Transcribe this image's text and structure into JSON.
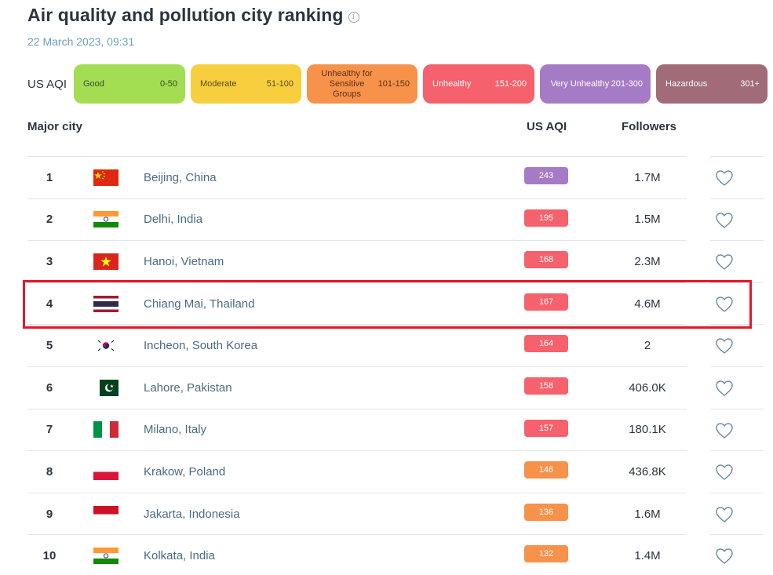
{
  "page": {
    "title": "Air quality and pollution city ranking",
    "info_icon_glyph": "i",
    "timestamp": "22 March 2023, 09:31"
  },
  "legend": {
    "label": "US AQI",
    "items": [
      {
        "name": "Good",
        "range": "0-50",
        "color": "#a3dd52",
        "text_color": "#3b4a2a",
        "width": 142
      },
      {
        "name": "Moderate",
        "range": "51-100",
        "color": "#f7cf3e",
        "text_color": "#5a4a1a",
        "width": 141
      },
      {
        "name": "Unhealthy for Sensitive Groups",
        "range": "101-150",
        "color": "#f7924a",
        "text_color": "#5a3218",
        "width": 141
      },
      {
        "name": "Unhealthy",
        "range": "151-200",
        "color": "#f5616c",
        "text_color": "#ffffff",
        "width": 142
      },
      {
        "name": "Very Unhealthy",
        "range": "201-300",
        "color": "#a57bc6",
        "text_color": "#ffffff",
        "width": 141
      },
      {
        "name": "Hazardous",
        "range": "301+",
        "color": "#a16b78",
        "text_color": "#ffffff",
        "width": 142
      }
    ]
  },
  "table": {
    "headers": {
      "city": "Major city",
      "aqi": "US AQI",
      "followers": "Followers"
    },
    "rows": [
      {
        "rank": "1",
        "flag": "china",
        "city": "Beijing, China",
        "aqi": "243",
        "aqi_color": "#a57bc6",
        "followers": "1.7M"
      },
      {
        "rank": "2",
        "flag": "india",
        "city": "Delhi, India",
        "aqi": "195",
        "aqi_color": "#f5616c",
        "followers": "1.5M"
      },
      {
        "rank": "3",
        "flag": "vietnam",
        "city": "Hanoi, Vietnam",
        "aqi": "168",
        "aqi_color": "#f5616c",
        "followers": "2.3M"
      },
      {
        "rank": "4",
        "flag": "thailand",
        "city": "Chiang Mai, Thailand",
        "aqi": "167",
        "aqi_color": "#f5616c",
        "followers": "4.6M"
      },
      {
        "rank": "5",
        "flag": "south-korea",
        "city": "Incheon, South Korea",
        "aqi": "164",
        "aqi_color": "#f5616c",
        "followers": "2"
      },
      {
        "rank": "6",
        "flag": "pakistan",
        "city": "Lahore, Pakistan",
        "aqi": "158",
        "aqi_color": "#f5616c",
        "followers": "406.0K"
      },
      {
        "rank": "7",
        "flag": "italy",
        "city": "Milano, Italy",
        "aqi": "157",
        "aqi_color": "#f5616c",
        "followers": "180.1K"
      },
      {
        "rank": "8",
        "flag": "poland",
        "city": "Krakow, Poland",
        "aqi": "146",
        "aqi_color": "#f7924a",
        "followers": "436.8K"
      },
      {
        "rank": "9",
        "flag": "indonesia",
        "city": "Jakarta, Indonesia",
        "aqi": "136",
        "aqi_color": "#f7924a",
        "followers": "1.6M"
      },
      {
        "rank": "10",
        "flag": "india",
        "city": "Kolkata, India",
        "aqi": "132",
        "aqi_color": "#f7924a",
        "followers": "1.4M"
      }
    ]
  },
  "icons": {
    "follow": "heart-icon",
    "info": "info-icon"
  },
  "colors": {
    "highlight": "#e3182d",
    "timestamp": "#6a9fc1",
    "city_text": "#4b6b85"
  }
}
